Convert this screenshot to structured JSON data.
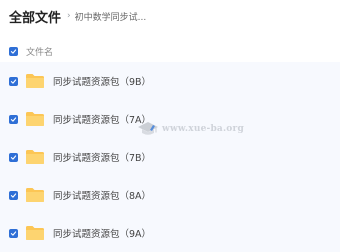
{
  "header": {
    "title": "全部文件",
    "separator": "›",
    "breadcrumb": "初中数学同步试..."
  },
  "list": {
    "column_header": "文件名",
    "files": [
      {
        "name": "同步试题资源包（9B）",
        "checked": true
      },
      {
        "name": "同步试题资源包（7A）",
        "checked": true
      },
      {
        "name": "同步试题资源包（7B）",
        "checked": true
      },
      {
        "name": "同步试题资源包（8A）",
        "checked": true
      },
      {
        "name": "同步试题资源包（9A）",
        "checked": true
      }
    ]
  },
  "watermark": {
    "text": "www.xue-ba.org"
  },
  "colors": {
    "checkbox": "#2f6fd6",
    "folder": "#fcc655",
    "row_background": "#f7f9fe"
  }
}
